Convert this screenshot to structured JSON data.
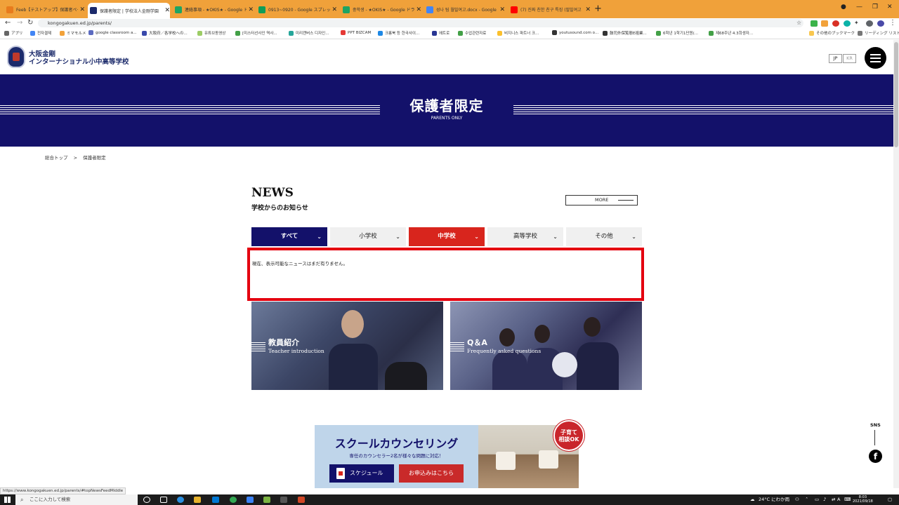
{
  "browser": {
    "tabs": [
      {
        "label": "Feeb【テストアップ】保護者ページ...",
        "color": "#f0a13a"
      },
      {
        "label": "保護者限定 | 学校法人金剛学園",
        "color": "#1b2a6b",
        "active": true
      },
      {
        "label": "連絡事項 - ★OKIS★ - Google ドラ",
        "color": "#1fa463"
      },
      {
        "label": "0913~0920 - Google スプレッドシー",
        "color": "#0f9d58"
      },
      {
        "label": "중학생 - ★OKIS★ - Google ドライ",
        "color": "#1fa463"
      },
      {
        "label": "성나 팀 월빌여고.docx - Google",
        "color": "#4285f4"
      },
      {
        "label": "(7) 진짜 친한 친구 특징 (필빌여고",
        "color": "#ff0000"
      }
    ],
    "url": "kongogakuen.ed.jp/parents/",
    "bookmarks": [
      "アプリ",
      "전자결제",
      "ミマモルメ",
      "google classroom a...",
      "大阪府／各学校への...",
      "유튜브동영상",
      "[미스터선사인 역사...",
      "미리캔버스 디자인...",
      "PPT BIZCAM",
      "크롬북 등 한국사이...",
      "에트로",
      "수업관련자료",
      "비지니스 파트너 크...",
      "youtusound.com o...",
      "鼓司外保覧懸E祖業...",
      "6학년 1학기1단원(...",
      "제68주년 4.3희생자...",
      "その他のブックマーク",
      "リーディング リスト"
    ]
  },
  "header": {
    "school_name_line1": "大阪金剛",
    "school_name_line2": "インターナショナル小中高等学校",
    "lang_jp": "JP",
    "lang_kr": "KR"
  },
  "hero": {
    "title": "保護者限定",
    "subtitle": "PARENTS ONLY"
  },
  "breadcrumb": {
    "home": "総合トップ",
    "separator": ">",
    "current": "保護者限定"
  },
  "news": {
    "title": "NEWS",
    "subtitle": "学校からのお知らせ",
    "more_label": "MORE",
    "tabs": [
      {
        "label": "すべて"
      },
      {
        "label": "小学校"
      },
      {
        "label": "中学校"
      },
      {
        "label": "高等学校"
      },
      {
        "label": "その他"
      }
    ],
    "empty_message": "現在、表示可能なニュースはまだ有りません。"
  },
  "cards": [
    {
      "title": "教員紹介",
      "subtitle": "Teacher introduction"
    },
    {
      "title": "Q＆A",
      "subtitle": "Frequently asked questions"
    }
  ],
  "sns": {
    "label": "SNS",
    "facebook": "f"
  },
  "banner": {
    "title": "スクールカウンセリング",
    "subtitle": "専任のカウンセラー2名が様々な問題に対応！",
    "schedule_label": "スケジュール",
    "apply_label": "お申込みはこちら",
    "badge_line1": "子育て",
    "badge_line2": "相談OK"
  },
  "status_url": "https://www.kongogakuen.ed.jp/parents/#topNewsFeedMiddle",
  "taskbar": {
    "search_placeholder": "ここに入力して検索",
    "weather": "24°C にわか雨",
    "ime": "A",
    "time": "8:03",
    "date": "2021/09/18"
  },
  "colors": {
    "navy": "#13116a",
    "red": "#d8251d",
    "highlight": "#e4000f"
  }
}
